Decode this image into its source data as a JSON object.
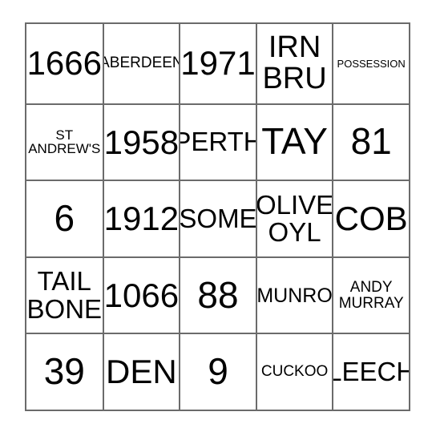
{
  "card": {
    "type": "bingo-card",
    "rows": 5,
    "columns": 5,
    "border_color": "#6b6b6b",
    "background_color": "#ffffff",
    "text_color": "#000000",
    "cells": [
      [
        {
          "text": "1666",
          "size": "xl"
        },
        {
          "text": "ABERDEEN",
          "size": "xs"
        },
        {
          "text": "1971",
          "size": "xl"
        },
        {
          "text": "IRN\nBRU",
          "size": "lg"
        },
        {
          "text": "POSSESSION",
          "size": "tiny"
        }
      ],
      [
        {
          "text": "ST\nANDREW'S",
          "size": "xxs"
        },
        {
          "text": "1958",
          "size": "xl"
        },
        {
          "text": "PERTH",
          "size": "md"
        },
        {
          "text": "TAY",
          "size": "xxl"
        },
        {
          "text": "81",
          "size": "xxl"
        }
      ],
      [
        {
          "text": "6",
          "size": "xxl"
        },
        {
          "text": "1912",
          "size": "xl"
        },
        {
          "text": "SOME",
          "size": "md"
        },
        {
          "text": "OLIVE\nOYL",
          "size": "md"
        },
        {
          "text": "COB",
          "size": "xl"
        }
      ],
      [
        {
          "text": "TAIL\nBONE",
          "size": "md"
        },
        {
          "text": "1066",
          "size": "xl"
        },
        {
          "text": "88",
          "size": "xxl"
        },
        {
          "text": "MUNRO",
          "size": "sm"
        },
        {
          "text": "ANDY\nMURRAY",
          "size": "xs"
        }
      ],
      [
        {
          "text": "39",
          "size": "xxl"
        },
        {
          "text": "DEN",
          "size": "xl"
        },
        {
          "text": "9",
          "size": "xxl"
        },
        {
          "text": "CUCKOO",
          "size": "xs"
        },
        {
          "text": "LEECH",
          "size": "md"
        }
      ]
    ]
  }
}
